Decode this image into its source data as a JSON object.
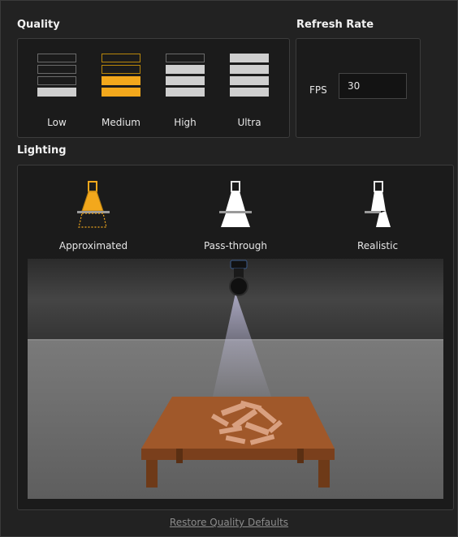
{
  "quality": {
    "title": "Quality",
    "options": [
      {
        "label": "Low",
        "level": 1
      },
      {
        "label": "Medium",
        "level": 2
      },
      {
        "label": "High",
        "level": 3
      },
      {
        "label": "Ultra",
        "level": 4
      }
    ],
    "selected": "Medium"
  },
  "refresh_rate": {
    "title": "Refresh Rate",
    "fps_label": "FPS",
    "fps_value": "30"
  },
  "lighting": {
    "title": "Lighting",
    "options": [
      {
        "label": "Approximated",
        "icon": "spotlight-approximated-icon"
      },
      {
        "label": "Pass-through",
        "icon": "spotlight-pass-through-icon"
      },
      {
        "label": "Realistic",
        "icon": "spotlight-realistic-icon"
      }
    ],
    "selected": "Approximated"
  },
  "footer": {
    "restore_label": "Restore Quality Defaults"
  },
  "colors": {
    "accent": "#f3a81c",
    "panel_bg": "#1b1b1b",
    "text": "#e6e6e6"
  }
}
